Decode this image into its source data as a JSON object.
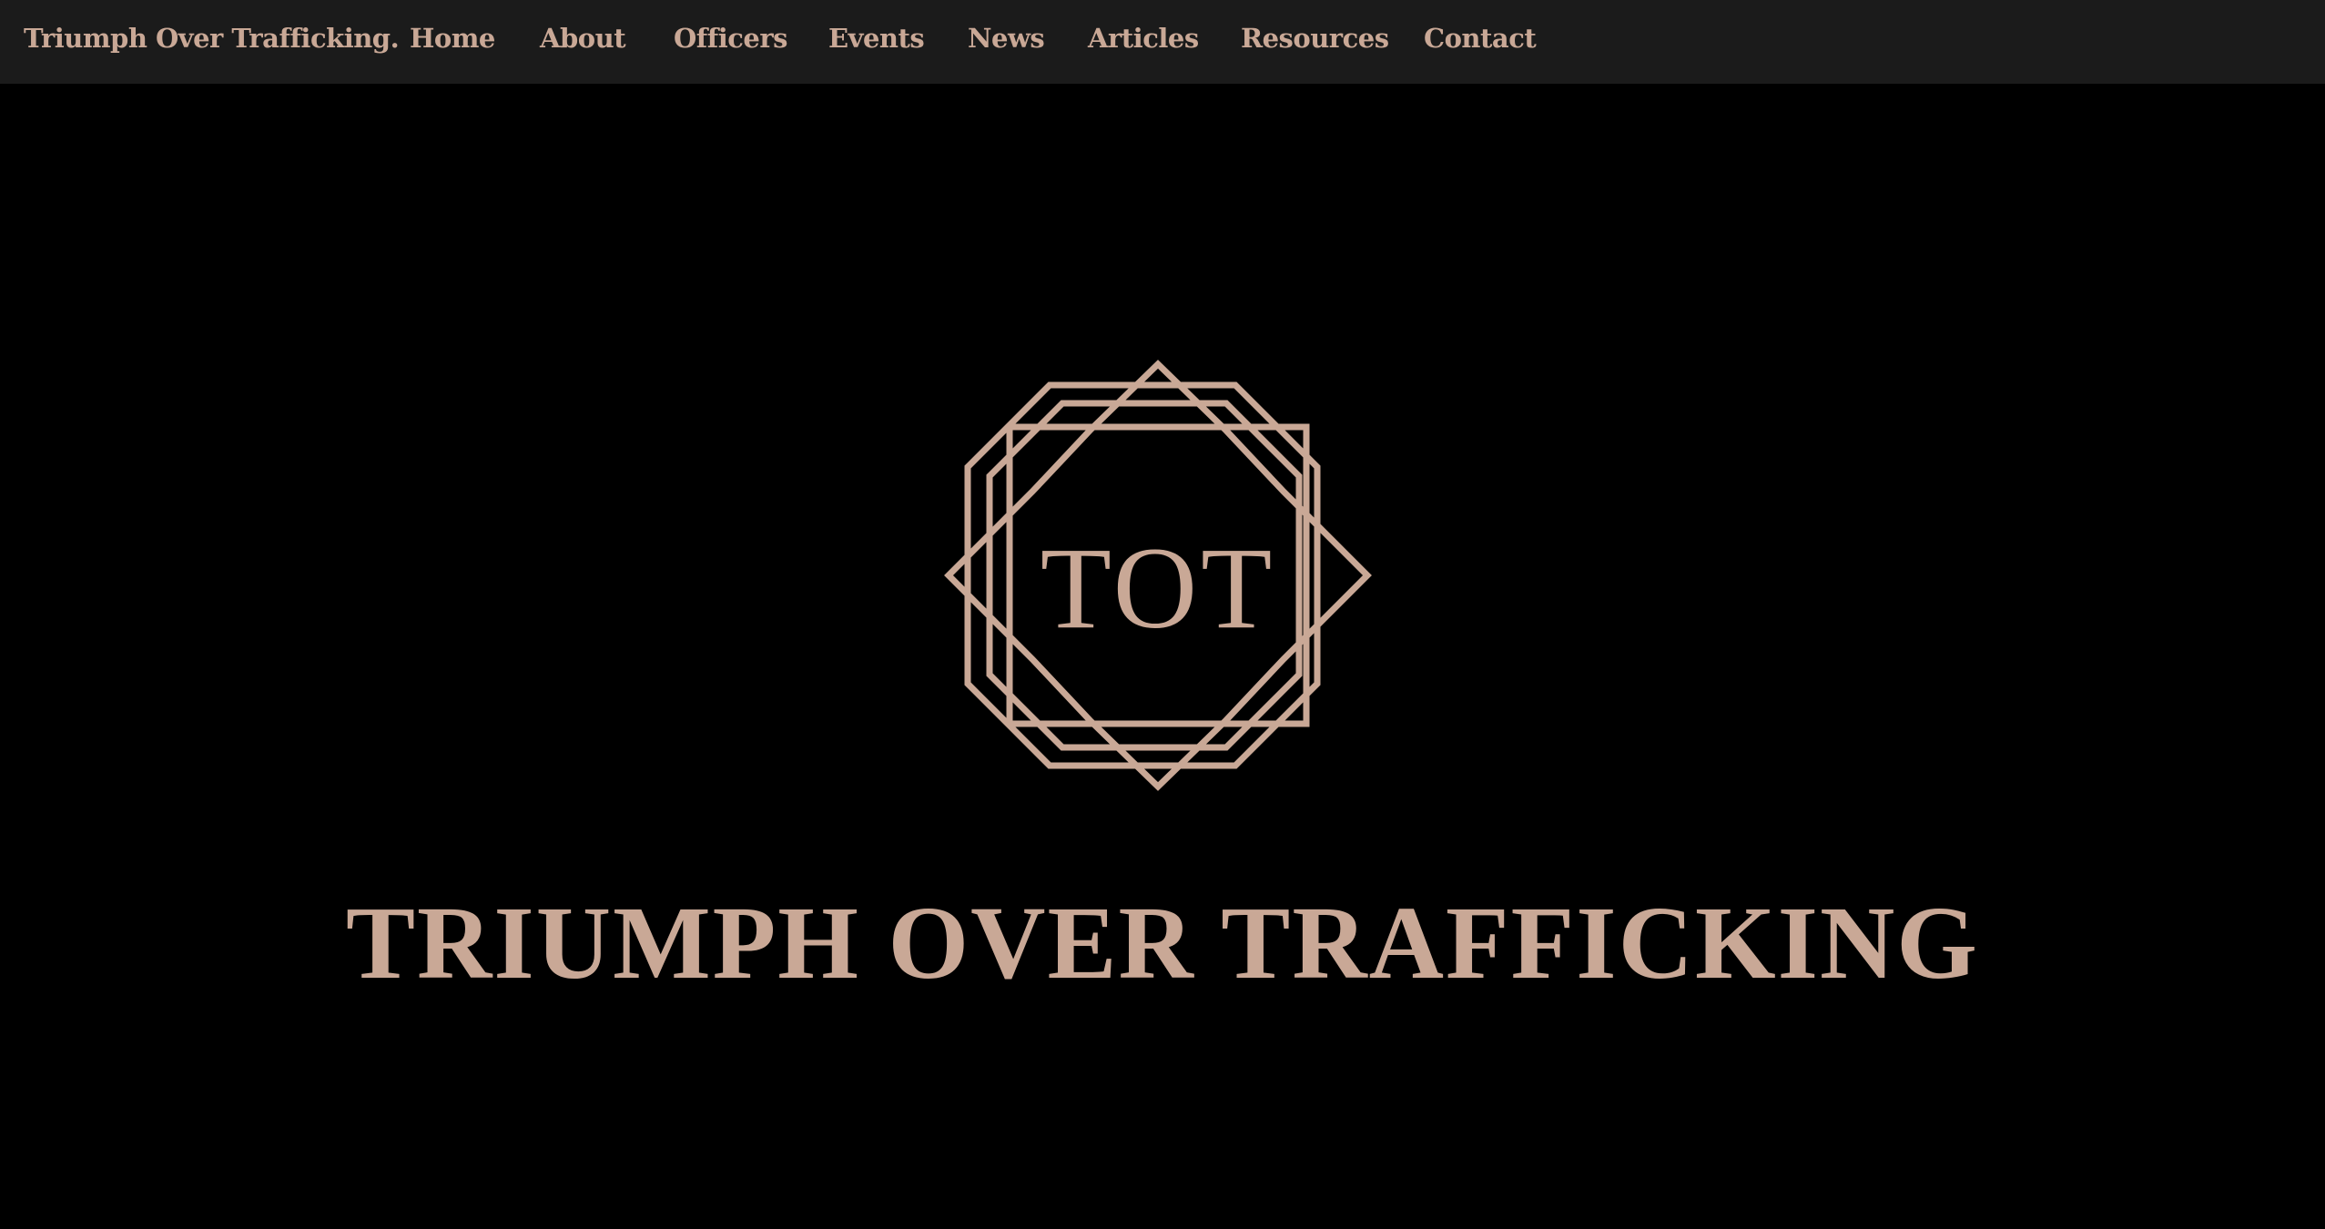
{
  "colors": {
    "accent": "#c9a896",
    "nav_background": "#1b1b1b",
    "background": "#000000"
  },
  "nav": {
    "brand": "Triumph Over Trafficking.",
    "items": [
      {
        "id": "home",
        "label": "Home"
      },
      {
        "id": "about",
        "label": "About"
      },
      {
        "id": "officers",
        "label": "Officers"
      },
      {
        "id": "events",
        "label": "Events"
      },
      {
        "id": "news",
        "label": "News"
      },
      {
        "id": "articles",
        "label": "Articles"
      },
      {
        "id": "resources",
        "label": "Resources"
      },
      {
        "id": "contact",
        "label": "Contact"
      }
    ]
  },
  "hero": {
    "logo_text": "TOT",
    "logo_icon": "geometric-octagon-emblem-icon",
    "title": "TRIUMPH OVER TRAFFICKING"
  }
}
